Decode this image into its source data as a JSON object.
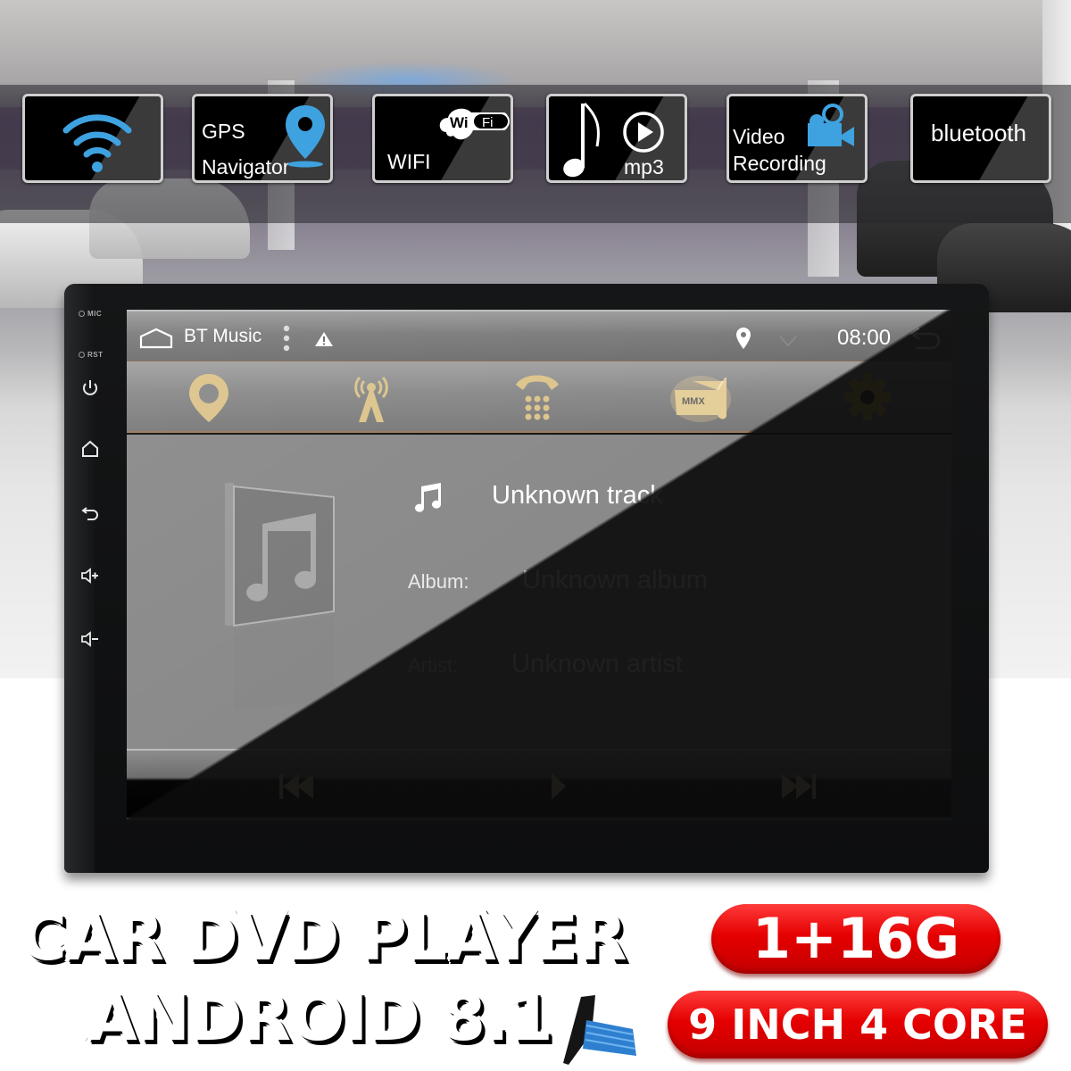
{
  "feature_tiles": [
    {
      "name": "wifi-signal",
      "icon": "wifi-signal-icon",
      "label": ""
    },
    {
      "name": "gps-navigator",
      "icon": "map-pin-icon",
      "label_line1": "GPS",
      "label_line2": "Navigator"
    },
    {
      "name": "wifi",
      "icon": "wifi-cloud-icon",
      "badge_left": "Wi",
      "badge_right": "Fi",
      "label": "WIFI"
    },
    {
      "name": "mp3",
      "icon": "music-play-icon",
      "label": "mp3"
    },
    {
      "name": "video-recording",
      "icon": "video-camera-icon",
      "label_line1": "Video",
      "label_line2": "Recording"
    },
    {
      "name": "bluetooth",
      "icon": "",
      "label": "bluetooth"
    }
  ],
  "device": {
    "side_labels": {
      "mic": "MIC",
      "rst": "RST"
    },
    "side_buttons": [
      "power-icon",
      "home-icon",
      "back-icon",
      "volume-up-icon",
      "volume-down-icon"
    ]
  },
  "screen": {
    "status_bar": {
      "home_icon": "home-outline-icon",
      "title": "BT Music",
      "menu_icon": "more-vertical-icon",
      "warning_icon": "warning-icon",
      "location_icon": "location-icon",
      "signal_icon": "signal-chevron-icon",
      "time": "08:00",
      "back_icon": "back-arrow-icon"
    },
    "app_bar": [
      {
        "name": "navigation",
        "icon": "map-pin-icon"
      },
      {
        "name": "radio",
        "icon": "radio-tower-icon"
      },
      {
        "name": "phone",
        "icon": "phone-dialpad-icon"
      },
      {
        "name": "file-manager",
        "icon": "folder-icon",
        "badge": "MMX"
      },
      {
        "name": "settings",
        "icon": "gear-icon"
      }
    ],
    "track": {
      "title": "Unknown track",
      "album_label": "Album:",
      "album": "Unknown album",
      "artist_label": "Artist:",
      "artist": "Unknown artist"
    },
    "transport": {
      "prev_icon": "skip-previous-icon",
      "play_icon": "play-icon",
      "next_icon": "skip-next-icon"
    }
  },
  "banner": {
    "headline_line1": "CAR DVD PLAYER",
    "headline_line2": "ANDROID 8.1",
    "spec_memory": "1+16G",
    "spec_screen": "9 INCH 4 CORE"
  },
  "colors": {
    "tile_icon_blue": "#3fa2e0",
    "gold_icon": "#d9c08a",
    "pill_red": "#e50000",
    "headline_orange": "#ff9a1c"
  }
}
